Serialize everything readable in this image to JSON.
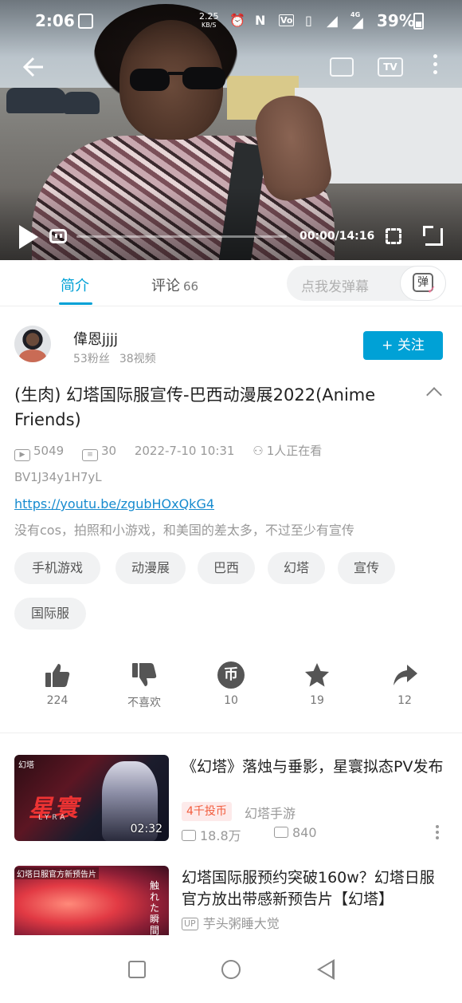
{
  "status_bar": {
    "time": "2:06",
    "net_speed": "2.25",
    "net_unit": "KB/S",
    "network": "4G",
    "battery": "39%"
  },
  "player": {
    "time_display": "00:00/14:16",
    "progress": 0,
    "top_tv_label": "TV"
  },
  "tabs": {
    "intro_label": "简介",
    "comments_label": "评论",
    "comments_count": "66",
    "danmu_placeholder": "点我发弹幕",
    "danmu_button": "弹"
  },
  "uploader": {
    "name": "偉恩jjjj",
    "fans": "53粉丝",
    "videos": "38视频",
    "follow_label": "+ 关注"
  },
  "video": {
    "title": "(生肉) 幻塔国际服宣传-巴西动漫展2022(Anime Friends)",
    "views": "5049",
    "danmaku": "30",
    "date": "2022-7-10 10:31",
    "watching": "1人正在看",
    "bvid": "BV1J34y1H7yL",
    "link": "https://youtu.be/zgubHOxQkG4",
    "description": "没有cos，拍照和小游戏，和美国的差太多，不过至少有宣传"
  },
  "tags": [
    "手机游戏",
    "动漫展",
    "巴西",
    "幻塔",
    "宣传",
    "国际服"
  ],
  "actions": {
    "like": "224",
    "dislike": "不喜欢",
    "coin": "10",
    "coin_glyph": "币",
    "favorite": "19",
    "share": "12"
  },
  "recommendations": [
    {
      "title": "《幻塔》落烛与垂影，星寰拟态PV发布",
      "badge": "4千投币",
      "uploader": "幻塔手游",
      "views": "18.8万",
      "danmaku": "840",
      "duration": "02:32",
      "thumb_brand": "幻塔",
      "thumb_logo": "星寰",
      "thumb_sub": "LYRA"
    },
    {
      "title": "幻塔国际服预约突破160w？幻塔日服官方放出带感新预告片【幻塔】",
      "uploader_tag": "UP",
      "uploader": "芋头粥睡大觉",
      "thumb_banner": "幻塔日服官方新预告片",
      "thumb_side": "触れた瞬間に"
    }
  ]
}
